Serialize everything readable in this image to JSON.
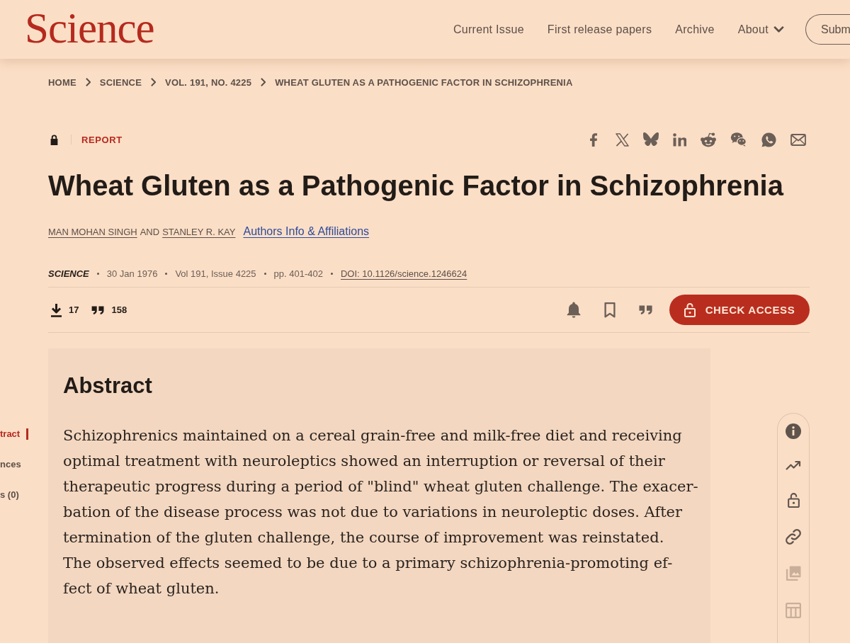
{
  "header": {
    "logo": "Science",
    "nav": [
      {
        "label": "Current Issue",
        "kind": "link"
      },
      {
        "label": "First release papers",
        "kind": "link"
      },
      {
        "label": "Archive",
        "kind": "link"
      },
      {
        "label": "About",
        "kind": "menu"
      }
    ],
    "submit_button": "Subm"
  },
  "breadcrumb": [
    "HOME",
    "SCIENCE",
    "VOL. 191, NO. 4225",
    "WHEAT GLUTEN AS A PATHOGENIC FACTOR IN SCHIZOPHRENIA"
  ],
  "article": {
    "type": "REPORT",
    "title": "Wheat Gluten as a Pathogenic Factor in Schizophrenia",
    "authors": [
      "MAN MOHAN SINGH",
      "STANLEY R. KAY"
    ],
    "author_separator": "AND",
    "affiliations_link": "Authors Info & Affiliations",
    "meta": {
      "journal": "SCIENCE",
      "details": [
        "30 Jan 1976",
        "Vol 191, Issue 4225",
        "pp. 401-402"
      ],
      "doi": "DOI: 10.1126/science.1246624"
    },
    "metrics": [
      {
        "kind": "downloads",
        "count": "17"
      },
      {
        "kind": "citations",
        "count": "158"
      }
    ],
    "check_access_button": "CHECK ACCESS"
  },
  "abstract": {
    "heading": "Abstract",
    "text": "Schizophrenics maintained on a cereal grain-free and milk-free diet and receiving\noptimal treatment with neuroleptics showed an interruption or reversal of their\ntherapeutic progress during a period of \"blind\" wheat gluten challenge. The exacer-\nbation of the disease process was not due to variations in neuroleptic doses. After\ntermination of the gluten challenge, the course of improvement was reinstated.\nThe observed effects seemed to be due to a primary schizophrenia-promoting ef-\nfect of wheat gluten."
  },
  "section_nav": [
    {
      "label": "tract",
      "selected": true
    },
    {
      "label": "nces",
      "selected": false
    },
    {
      "label": "s (0)",
      "selected": false
    }
  ],
  "tool_rail": [
    {
      "kind": "info",
      "disabled": false
    },
    {
      "kind": "trend",
      "disabled": false
    },
    {
      "kind": "access",
      "disabled": false
    },
    {
      "kind": "link",
      "disabled": false
    },
    {
      "kind": "figures",
      "disabled": true
    },
    {
      "kind": "tables",
      "disabled": true
    }
  ]
}
